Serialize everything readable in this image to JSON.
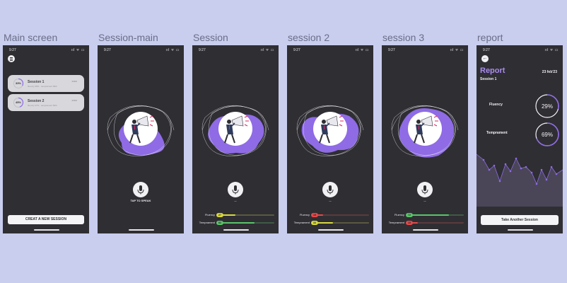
{
  "frames": [
    {
      "title": "Main screen"
    },
    {
      "title": "Session-main"
    },
    {
      "title": "Session"
    },
    {
      "title": "session 2"
    },
    {
      "title": "session 3"
    },
    {
      "title": "report"
    }
  ],
  "status_bar": {
    "time": "9:27",
    "icons": "ııl ᯤ ▭"
  },
  "main_screen": {
    "sessions": [
      {
        "percent": "33%",
        "title": "Session 1",
        "subtitle": "fluency 29% · temprament 69%",
        "date": "23/02"
      },
      {
        "percent": "45%",
        "title": "Session 2",
        "subtitle": "fluency 27% · temprament 50%",
        "date": "23/02"
      }
    ],
    "create_label": "CREAT A NEW SESSION"
  },
  "session_main": {
    "tap_label": "TAP TO SPEAK"
  },
  "session": {
    "fluency_label": "Fluency",
    "fluency_value": "27",
    "temprament_label": "Temprament",
    "temprament_value": "63",
    "dots": "..."
  },
  "session2": {
    "fluency_label": "Fluency",
    "fluency_value": "15",
    "temprament_label": "Temprament",
    "temprament_value": "33",
    "dots": "..."
  },
  "session3": {
    "fluency_label": "Fluency",
    "fluency_value": "72",
    "temprament_label": "Temprament",
    "temprament_value": "15",
    "dots": "..."
  },
  "report": {
    "title": "Report",
    "date": "23 feb'23",
    "session": "Session 1",
    "fluency_label": "Fluency",
    "fluency_value": "29%",
    "temprament_label": "Temprament",
    "temprament_value": "69%",
    "take_another_label": "Take Another Session"
  },
  "colors": {
    "accent": "#8f6be6",
    "green": "#5ac46a",
    "yellow": "#d8d840",
    "red": "#e24a4a",
    "phone_bg": "#2f2e33",
    "canvas_bg": "#c9cdee"
  }
}
